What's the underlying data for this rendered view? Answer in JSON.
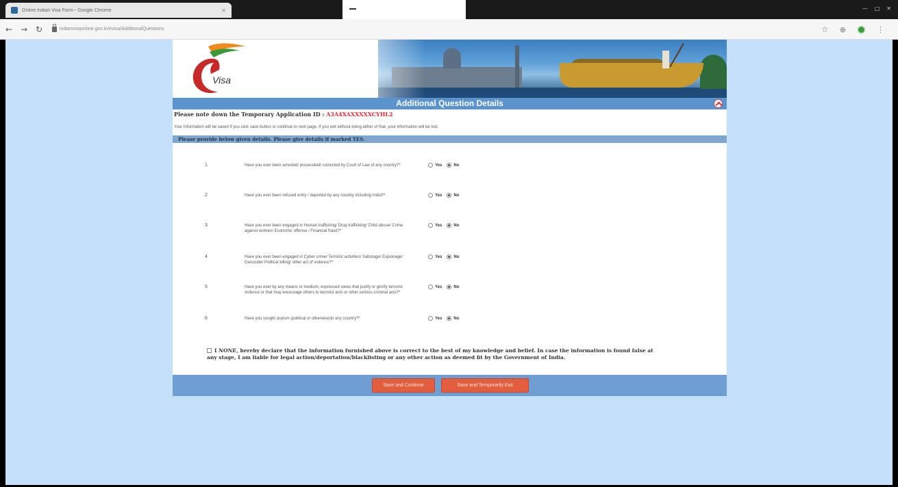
{
  "browser": {
    "tab_title": "Online Indian Visa Form - Google Chrome",
    "url": "indianvisaonline.gov.in/evisa/AdditionalQuestions"
  },
  "logo": {
    "text": "Visa"
  },
  "header": {
    "title": "Additional Question Details"
  },
  "temp_id": {
    "label": "Please note down the Temporary Application ID : ",
    "value": "A3A4XAXXXXXCYHL2"
  },
  "info_note": "Your Information will be saved if you click save button or continue to next page. If you exit without doing either of that, your information will be lost.",
  "section_title": "Please provide below given details. Please give details if marked YES.",
  "questions": [
    {
      "num": "1",
      "text": "Have you ever been arrested/ prosecuted/ convicted by Court of Law of any country?*",
      "yes": "Yes",
      "no": "No",
      "selected": "no"
    },
    {
      "num": "2",
      "text": "Have you ever been refused entry / deported by any country including India?*",
      "yes": "Yes",
      "no": "No",
      "selected": "no"
    },
    {
      "num": "3",
      "text": "Have you ever been engaged in Human trafficking/ Drug trafficking/ Child abuse/ Crime against women/ Economic offense / Financial fraud?*",
      "yes": "Yes",
      "no": "No",
      "selected": "no"
    },
    {
      "num": "4",
      "text": "Have you ever been engaged in Cyber crime/ Terrorist activities/ Sabotage/ Espionage/ Genocide/ Political killing/ other act of violence?*",
      "yes": "Yes",
      "no": "No",
      "selected": "no"
    },
    {
      "num": "5",
      "text": "Have you ever by any means or medium, expressed views that justify or glorify terrorist violence or that may encourage others to terrorist acts or other serious criminal acts?*",
      "yes": "Yes",
      "no": "No",
      "selected": "no"
    },
    {
      "num": "6",
      "text": "Have you sought asylum (political or otherwise)in any country?*",
      "yes": "Yes",
      "no": "No",
      "selected": "no"
    }
  ],
  "declaration": {
    "prefix": "I ",
    "name": "NONE",
    "text": ", hereby declare that the information furnished above is correct to the best of my knowledge and belief. In case the information is found false at any stage, I am liable for legal action/deportation/blacklisting or any other action as deemed fit by the Government of India."
  },
  "buttons": {
    "save_continue": "Save and Continue",
    "save_exit": "Save and Temporarily Exit"
  },
  "colors": {
    "page_bg": "#c4e0fa",
    "header_bar": "#5b93cf",
    "button": "#e35e3e",
    "id_text": "#e0303a"
  }
}
